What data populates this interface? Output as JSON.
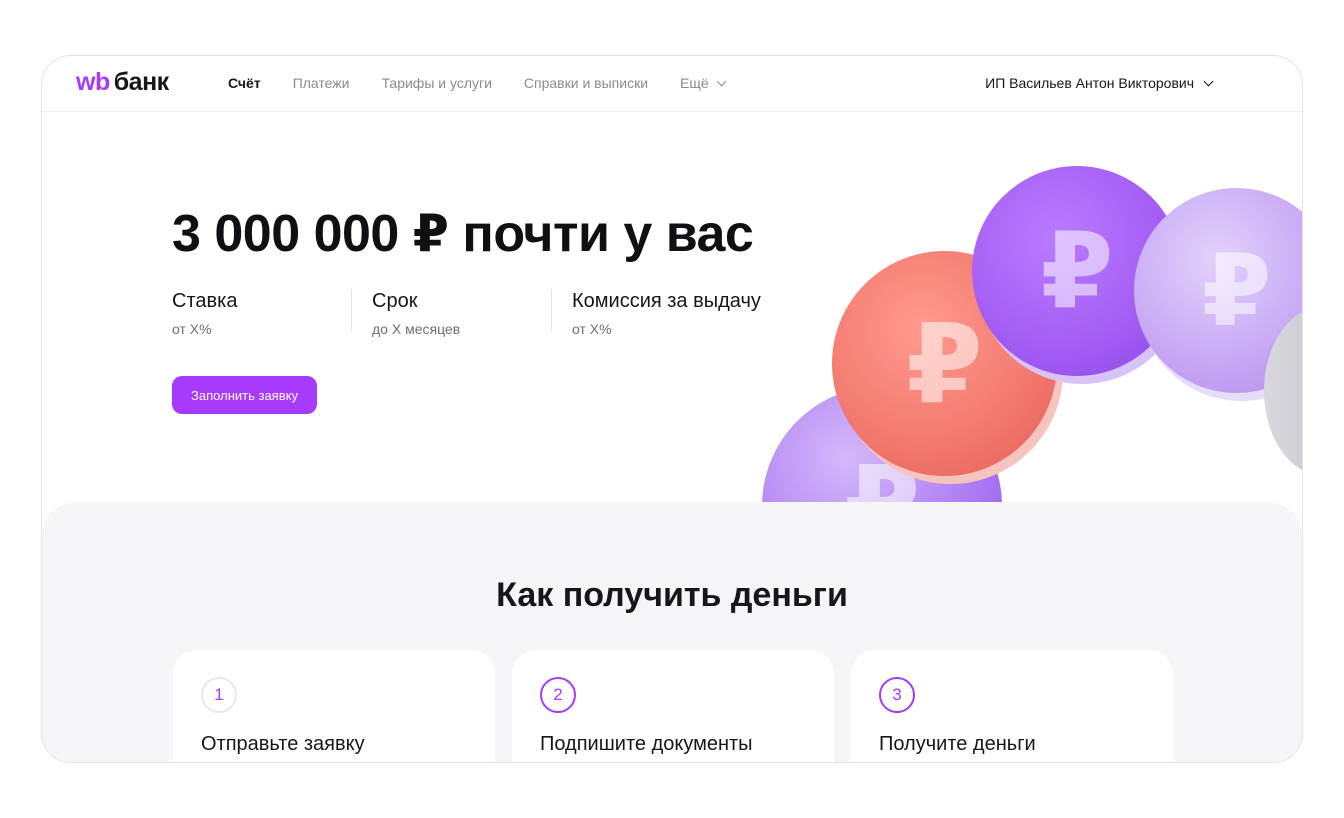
{
  "header": {
    "logo_wb": "wb",
    "logo_bank": "банк",
    "nav": [
      "Счёт",
      "Платежи",
      "Тарифы и услуги",
      "Справки и выписки"
    ],
    "more": "Ещё",
    "user": "ИП Васильев Антон Викторович"
  },
  "hero": {
    "title": "3 000 000 ₽ почти у вас",
    "params": [
      {
        "label": "Ставка",
        "value": "от X%"
      },
      {
        "label": "Срок",
        "value": "до X месяцев"
      },
      {
        "label": "Комиссия за выдачу",
        "value": "от X%"
      }
    ],
    "cta": "Заполнить заявку",
    "coin_symbol": "₽"
  },
  "steps": {
    "title": "Как получить деньги",
    "items": [
      {
        "num": "1",
        "title": "Отправьте заявку"
      },
      {
        "num": "2",
        "title": "Подпишите документы"
      },
      {
        "num": "3",
        "title": "Получите деньги"
      }
    ]
  },
  "colors": {
    "accent": "#a73afd",
    "text": "#16161d",
    "muted": "#8a8a95",
    "coin_purple": "#a35cf3",
    "coin_coral": "#f2776c",
    "coin_lilac": "#c5a5f4"
  }
}
